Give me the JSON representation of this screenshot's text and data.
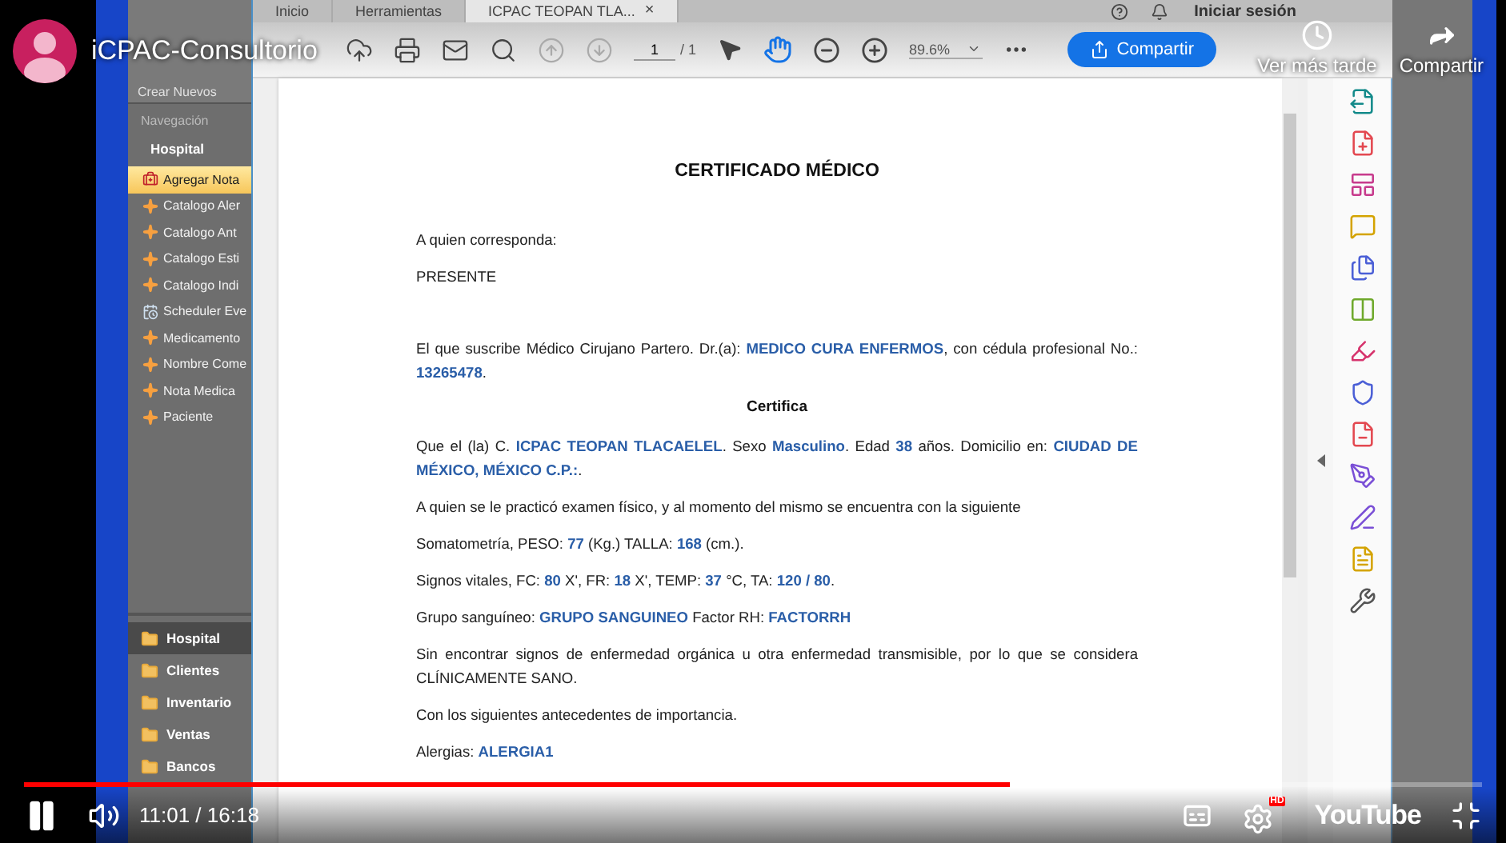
{
  "player": {
    "channel_title": "iCPAC-Consultorio",
    "watch_later": "Ver más tarde",
    "share": "Compartir",
    "time": "11:01 / 16:18",
    "progress": {
      "level": 0.676
    },
    "logo": "YouTube",
    "quality_badge": "HD"
  },
  "app": {
    "create_label": "Crear Nuevos",
    "nav_header": "Navegación",
    "nav_group": "Hospital",
    "nav_items": [
      {
        "label": "Agregar Nota",
        "kind": "add",
        "selected": true
      },
      {
        "label": "Catalogo Aler",
        "kind": "catalog",
        "selected": false
      },
      {
        "label": "Catalogo Ant",
        "kind": "catalog",
        "selected": false
      },
      {
        "label": "Catalogo Esti",
        "kind": "catalog",
        "selected": false
      },
      {
        "label": "Catalogo Indi",
        "kind": "catalog",
        "selected": false
      },
      {
        "label": "Scheduler Eve",
        "kind": "scheduler",
        "selected": false
      },
      {
        "label": "Medicamento",
        "kind": "catalog",
        "selected": false
      },
      {
        "label": "Nombre Come",
        "kind": "catalog",
        "selected": false
      },
      {
        "label": "Nota Medica",
        "kind": "catalog",
        "selected": false
      },
      {
        "label": "Paciente",
        "kind": "catalog",
        "selected": false
      }
    ],
    "modules": [
      {
        "label": "Hospital",
        "selected": true
      },
      {
        "label": "Clientes",
        "selected": false
      },
      {
        "label": "Inventario",
        "selected": false
      },
      {
        "label": "Ventas",
        "selected": false
      },
      {
        "label": "Bancos",
        "selected": false
      }
    ]
  },
  "viewer": {
    "tabs": [
      {
        "label": "Inicio",
        "selected": false
      },
      {
        "label": "Herramientas",
        "selected": false
      },
      {
        "label": "ICPAC TEOPAN TLA...",
        "selected": true,
        "close": "×"
      }
    ],
    "sign_in": "Iniciar sesión",
    "page_number": "1",
    "page_total": "/ 1",
    "zoom": "89.6%",
    "share_button": "Compartir"
  },
  "document": [
    {
      "kind": "title",
      "text": "CERTIFICADO MÉDICO"
    },
    {
      "kind": "para",
      "text": "A quien corresponda:"
    },
    {
      "kind": "para",
      "text": "PRESENTE"
    },
    {
      "kind": "gap"
    },
    {
      "kind": "para",
      "text": "El que suscribe Médico Cirujano Partero. Dr.(a): **MEDICO CURA ENFERMOS**, con cédula profesional No.: **13265478**."
    },
    {
      "kind": "heading",
      "text": "Certifica"
    },
    {
      "kind": "para",
      "text": "Que el (la) C. **ICPAC TEOPAN TLACAELEL**. Sexo **Masculino**. Edad **38** años. Domicilio en:      **CIUDAD DE MÉXICO, MÉXICO C.P.:**."
    },
    {
      "kind": "para",
      "text": "A quien se le practicó examen físico, y al momento del mismo se encuentra con la siguiente"
    },
    {
      "kind": "para",
      "text": "Somatometría, PESO: **77** (Kg.)    TALLA: **168** (cm.)."
    },
    {
      "kind": "para",
      "text": "Signos vitales,  FC: **80** X', FR: **18** X', TEMP: **37** °C, TA: **120 / 80**."
    },
    {
      "kind": "para",
      "text": "Grupo sanguíneo: **GRUPO SANGUINEO** Factor RH:  **FACTORRH**"
    },
    {
      "kind": "para",
      "text": "Sin encontrar signos de enfermedad orgánica u otra enfermedad transmisible, por lo que se considera  CLÍNICAMENTE SANO."
    },
    {
      "kind": "para",
      "text": "Con los siguientes antecedentes de importancia."
    },
    {
      "kind": "para",
      "text": "Alergias: **ALERGIA1**"
    }
  ]
}
